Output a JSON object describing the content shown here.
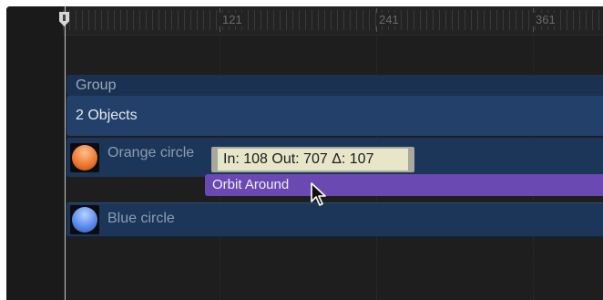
{
  "ruler": {
    "labels": [
      "121",
      "241",
      "361"
    ]
  },
  "tracks": {
    "group_label": "Group",
    "objects_label": "2 Objects",
    "orange_label": "Orange circle",
    "blue_label": "Blue circle"
  },
  "behavior": {
    "label": "Orbit Around"
  },
  "tooltip": {
    "text": "In: 108 Out: 707 Δ: 107"
  },
  "icons": {
    "playhead": "playhead-marker-icon",
    "orange_thumb": "orange-circle-thumbnail",
    "blue_thumb": "blue-circle-thumbnail",
    "cursor": "pointer-cursor-icon"
  },
  "colors": {
    "group_bar": "#1a3151",
    "objects_bar": "#22406a",
    "layer_bar": "#1b3658",
    "behavior_bar": "#6a4ab2",
    "tooltip_bg": "#e8e6c8"
  }
}
